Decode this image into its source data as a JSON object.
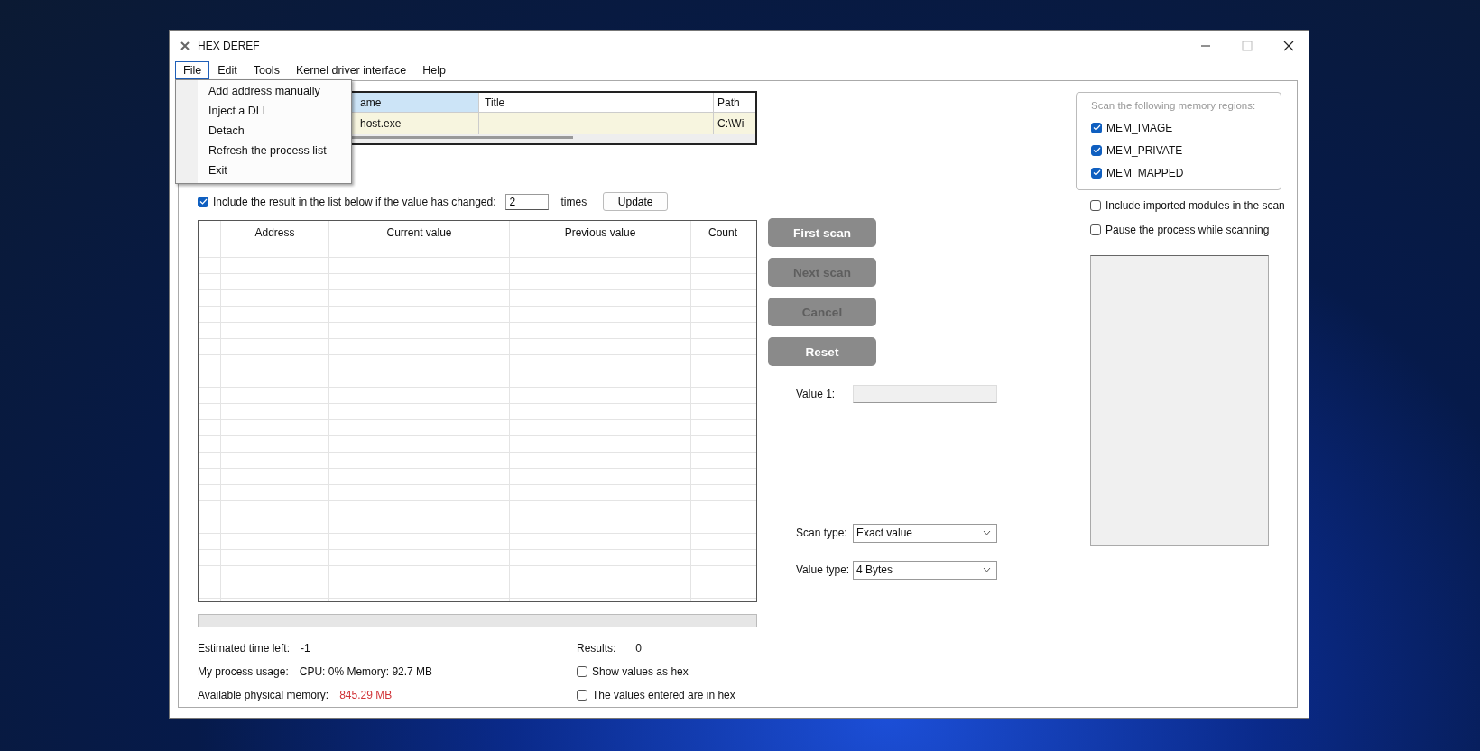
{
  "window": {
    "title": "HEX DEREF"
  },
  "menu": [
    {
      "label": "File",
      "selected": true
    },
    {
      "label": "Edit",
      "selected": false
    },
    {
      "label": "Tools",
      "selected": false
    },
    {
      "label": "Kernel driver interface",
      "selected": false
    },
    {
      "label": "Help",
      "selected": false
    }
  ],
  "file_menu": {
    "items": [
      "Add address manually",
      "Inject a DLL",
      "Detach",
      "Refresh the process list",
      "Exit"
    ]
  },
  "process_table": {
    "columns": [
      {
        "label": "ame",
        "selected": true
      },
      {
        "label": "Title",
        "selected": false
      },
      {
        "label": "Path",
        "selected": false
      }
    ],
    "rows": [
      {
        "name": "host.exe",
        "path": "C:\\Wi"
      }
    ]
  },
  "change_filter": {
    "checked": true,
    "label": "Include the result in the list below if the value has changed:",
    "value": "2",
    "unit": "times",
    "button": "Update"
  },
  "results_table": {
    "columns": [
      "Address",
      "Current value",
      "Previous value",
      "Count"
    ]
  },
  "scan_buttons": [
    {
      "label": "First scan",
      "disabled": false
    },
    {
      "label": "Next scan",
      "disabled": true
    },
    {
      "label": "Cancel",
      "disabled": true
    },
    {
      "label": "Reset",
      "disabled": false
    }
  ],
  "value_1": {
    "label": "Value 1:"
  },
  "scan_type": {
    "label": "Scan type:",
    "value": "Exact value"
  },
  "value_type": {
    "label": "Value type:",
    "value": "4 Bytes"
  },
  "memory_regions": {
    "title": "Scan the following memory regions:",
    "options": [
      {
        "label": "MEM_IMAGE",
        "checked": true
      },
      {
        "label": "MEM_PRIVATE",
        "checked": true
      },
      {
        "label": "MEM_MAPPED",
        "checked": true
      }
    ]
  },
  "options": [
    {
      "label": "Include imported modules in the scan",
      "checked": false
    },
    {
      "label": "Pause the process while scanning",
      "checked": false
    }
  ],
  "progress": {
    "level": 0
  },
  "stats": [
    {
      "label": "Estimated time left:",
      "value": "-1",
      "kind": "normal"
    },
    {
      "label": "My process usage:",
      "value": "CPU: 0% Memory: 92.7 MB",
      "kind": "normal"
    },
    {
      "label": "Available physical memory:",
      "value": "845.29 MB",
      "kind": "warning"
    }
  ],
  "results": {
    "label": "Results:",
    "value": "0"
  },
  "hex_options": [
    {
      "label": "Show values as hex",
      "checked": false
    },
    {
      "label": "The values entered are in hex",
      "checked": false
    }
  ]
}
